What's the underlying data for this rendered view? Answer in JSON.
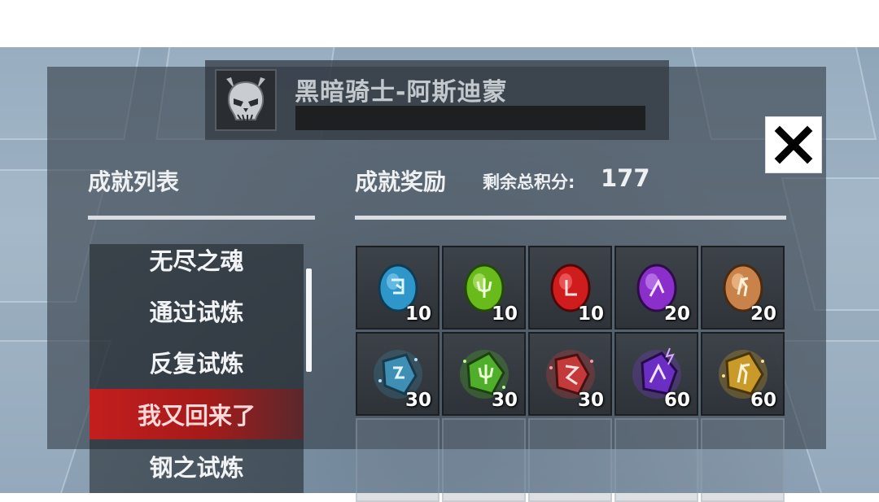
{
  "boss": {
    "name": "黑暗骑士-阿斯迪蒙",
    "icon": "demon-skull-icon"
  },
  "close_button": {
    "label": "✕",
    "icon": "close-icon"
  },
  "achievements": {
    "title": "成就列表",
    "items": [
      {
        "label": "无尽之魂",
        "selected": false
      },
      {
        "label": "通过试炼",
        "selected": false
      },
      {
        "label": "反复试炼",
        "selected": false
      },
      {
        "label": "我又回来了",
        "selected": true
      },
      {
        "label": "钢之试炼",
        "selected": false
      }
    ]
  },
  "rewards": {
    "title": "成就奖励",
    "points_label": "剩余总积分:",
    "points_value": "177",
    "slots": [
      {
        "icon": "blue-rune-stone-icon",
        "count": "10",
        "color": "#3aa6d8"
      },
      {
        "icon": "green-rune-stone-icon",
        "count": "10",
        "color": "#6cc21e"
      },
      {
        "icon": "red-rune-stone-icon",
        "count": "10",
        "color": "#d41f1f"
      },
      {
        "icon": "purple-rune-stone-icon",
        "count": "20",
        "color": "#8a2fc9"
      },
      {
        "icon": "orange-rune-stone-icon",
        "count": "20",
        "color": "#d8903f"
      },
      {
        "icon": "blue-glowing-rune-crystal-icon",
        "count": "30",
        "color": "#3f8fb5"
      },
      {
        "icon": "green-glowing-rune-crystal-icon",
        "count": "30",
        "color": "#4fae2a"
      },
      {
        "icon": "red-glowing-rune-crystal-icon",
        "count": "30",
        "color": "#c23a3a"
      },
      {
        "icon": "purple-glowing-rune-crystal-icon",
        "count": "60",
        "color": "#7a3ad0"
      },
      {
        "icon": "gold-glowing-rune-crystal-icon",
        "count": "60",
        "color": "#c99a2a"
      },
      {
        "icon": "",
        "count": ""
      },
      {
        "icon": "",
        "count": ""
      },
      {
        "icon": "",
        "count": ""
      },
      {
        "icon": "",
        "count": ""
      },
      {
        "icon": "",
        "count": ""
      }
    ]
  },
  "colors": {
    "selected_item": "#c41e1e",
    "panel_overlay": "#373f48",
    "divider": "#d9dde1"
  }
}
